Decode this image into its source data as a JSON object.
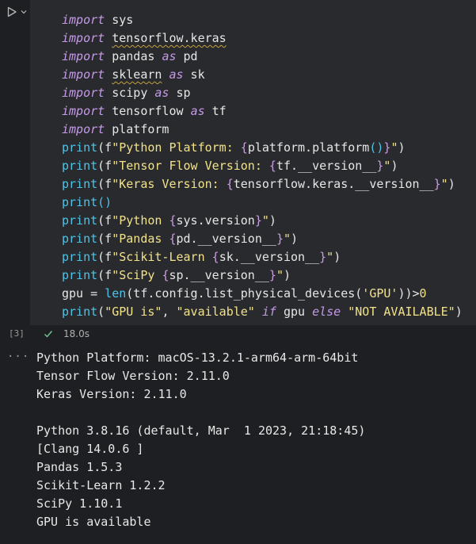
{
  "cell": {
    "execution_count": "[3]",
    "duration": "18.0s",
    "code_lines": [
      [
        {
          "t": "import",
          "c": "kw"
        },
        {
          "t": " sys"
        }
      ],
      [
        {
          "t": "import",
          "c": "kw"
        },
        {
          "t": " "
        },
        {
          "t": "tensorflow.keras",
          "c": "wavy"
        }
      ],
      [
        {
          "t": "import",
          "c": "kw"
        },
        {
          "t": " pandas "
        },
        {
          "t": "as",
          "c": "kw"
        },
        {
          "t": " pd"
        }
      ],
      [
        {
          "t": "import",
          "c": "kw"
        },
        {
          "t": " "
        },
        {
          "t": "sklearn",
          "c": "wavy"
        },
        {
          "t": " "
        },
        {
          "t": "as",
          "c": "kw"
        },
        {
          "t": " sk"
        }
      ],
      [
        {
          "t": "import",
          "c": "kw"
        },
        {
          "t": " scipy "
        },
        {
          "t": "as",
          "c": "kw"
        },
        {
          "t": " sp"
        }
      ],
      [
        {
          "t": "import",
          "c": "kw"
        },
        {
          "t": " tensorflow "
        },
        {
          "t": "as",
          "c": "kw"
        },
        {
          "t": " tf"
        }
      ],
      [
        {
          "t": "import",
          "c": "kw"
        },
        {
          "t": " platform"
        }
      ],
      [
        {
          "t": "print",
          "c": "fn"
        },
        {
          "t": "(f"
        },
        {
          "t": "\"Python Platform: ",
          "c": "str"
        },
        {
          "t": "{",
          "c": "brace"
        },
        {
          "t": "platform.platform"
        },
        {
          "t": "()",
          "c": "fn"
        },
        {
          "t": "}",
          "c": "brace"
        },
        {
          "t": "\"",
          "c": "str"
        },
        {
          "t": ")"
        }
      ],
      [
        {
          "t": "print",
          "c": "fn"
        },
        {
          "t": "(f"
        },
        {
          "t": "\"Tensor Flow Version: ",
          "c": "str"
        },
        {
          "t": "{",
          "c": "brace"
        },
        {
          "t": "tf.__version__"
        },
        {
          "t": "}",
          "c": "brace"
        },
        {
          "t": "\"",
          "c": "str"
        },
        {
          "t": ")"
        }
      ],
      [
        {
          "t": "print",
          "c": "fn"
        },
        {
          "t": "(f"
        },
        {
          "t": "\"Keras Version: ",
          "c": "str"
        },
        {
          "t": "{",
          "c": "brace"
        },
        {
          "t": "tensorflow.keras.__version__"
        },
        {
          "t": "}",
          "c": "brace"
        },
        {
          "t": "\"",
          "c": "str"
        },
        {
          "t": ")"
        }
      ],
      [
        {
          "t": "print",
          "c": "fn"
        },
        {
          "t": "()",
          "c": "fn"
        }
      ],
      [
        {
          "t": "print",
          "c": "fn"
        },
        {
          "t": "(f"
        },
        {
          "t": "\"Python ",
          "c": "str"
        },
        {
          "t": "{",
          "c": "brace"
        },
        {
          "t": "sys.version"
        },
        {
          "t": "}",
          "c": "brace"
        },
        {
          "t": "\"",
          "c": "str"
        },
        {
          "t": ")"
        }
      ],
      [
        {
          "t": "print",
          "c": "fn"
        },
        {
          "t": "(f"
        },
        {
          "t": "\"Pandas ",
          "c": "str"
        },
        {
          "t": "{",
          "c": "brace"
        },
        {
          "t": "pd.__version__"
        },
        {
          "t": "}",
          "c": "brace"
        },
        {
          "t": "\"",
          "c": "str"
        },
        {
          "t": ")"
        }
      ],
      [
        {
          "t": "print",
          "c": "fn"
        },
        {
          "t": "(f"
        },
        {
          "t": "\"Scikit-Learn ",
          "c": "str"
        },
        {
          "t": "{",
          "c": "brace"
        },
        {
          "t": "sk.__version__"
        },
        {
          "t": "}",
          "c": "brace"
        },
        {
          "t": "\"",
          "c": "str"
        },
        {
          "t": ")"
        }
      ],
      [
        {
          "t": "print",
          "c": "fn"
        },
        {
          "t": "(f"
        },
        {
          "t": "\"SciPy ",
          "c": "str"
        },
        {
          "t": "{",
          "c": "brace"
        },
        {
          "t": "sp.__version__"
        },
        {
          "t": "}",
          "c": "brace"
        },
        {
          "t": "\"",
          "c": "str"
        },
        {
          "t": ")"
        }
      ],
      [
        {
          "t": "gpu = "
        },
        {
          "t": "len",
          "c": "fn"
        },
        {
          "t": "(tf.config.list_physical_devices("
        },
        {
          "t": "'GPU'",
          "c": "str"
        },
        {
          "t": "))>"
        },
        {
          "t": "0",
          "c": "str"
        }
      ],
      [
        {
          "t": "print",
          "c": "fn"
        },
        {
          "t": "("
        },
        {
          "t": "\"GPU is\"",
          "c": "str"
        },
        {
          "t": ", "
        },
        {
          "t": "\"available\"",
          "c": "str"
        },
        {
          "t": " "
        },
        {
          "t": "if",
          "c": "kw"
        },
        {
          "t": " gpu "
        },
        {
          "t": "else",
          "c": "kw"
        },
        {
          "t": " "
        },
        {
          "t": "\"NOT AVAILABLE\"",
          "c": "str"
        },
        {
          "t": ")"
        }
      ]
    ]
  },
  "output_lines": [
    "Python Platform: macOS-13.2.1-arm64-arm-64bit",
    "Tensor Flow Version: 2.11.0",
    "Keras Version: 2.11.0",
    "",
    "Python 3.8.16 (default, Mar  1 2023, 21:18:45)",
    "[Clang 14.0.6 ]",
    "Pandas 1.5.3",
    "Scikit-Learn 1.2.2",
    "SciPy 1.10.1",
    "GPU is available"
  ],
  "icons": {
    "run": "run-icon",
    "chevron": "chevron-down-icon",
    "check": "check-icon",
    "more": "more-icon",
    "more_glyph": "···"
  },
  "colors": {
    "keyword": "#c59ae8",
    "function": "#4fc3e8",
    "string": "#f2e28a",
    "success": "#73c991"
  }
}
